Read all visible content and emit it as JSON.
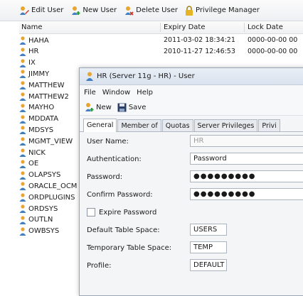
{
  "toolbar": {
    "edit_user": "Edit User",
    "new_user": "New User",
    "delete_user": "Delete User",
    "privilege_manager": "Privilege Manager"
  },
  "columns": {
    "name": "Name",
    "expiry": "Expiry Date",
    "lock": "Lock Date"
  },
  "users": [
    {
      "name": "HAHA",
      "expiry": "2011-03-02 18:34:21",
      "lock": "0000-00-00 00"
    },
    {
      "name": "HR",
      "expiry": "2010-11-27 12:46:53",
      "lock": "0000-00-00 00"
    },
    {
      "name": "IX",
      "expiry": "",
      "lock": ""
    },
    {
      "name": "JIMMY",
      "expiry": "",
      "lock": ""
    },
    {
      "name": "MATTHEW",
      "expiry": "",
      "lock": ""
    },
    {
      "name": "MATTHEW2",
      "expiry": "",
      "lock": ""
    },
    {
      "name": "MAYHO",
      "expiry": "",
      "lock": ""
    },
    {
      "name": "MDDATA",
      "expiry": "",
      "lock": ""
    },
    {
      "name": "MDSYS",
      "expiry": "",
      "lock": ""
    },
    {
      "name": "MGMT_VIEW",
      "expiry": "",
      "lock": ""
    },
    {
      "name": "NICK",
      "expiry": "",
      "lock": ""
    },
    {
      "name": "OE",
      "expiry": "",
      "lock": ""
    },
    {
      "name": "OLAPSYS",
      "expiry": "",
      "lock": ""
    },
    {
      "name": "ORACLE_OCM",
      "expiry": "",
      "lock": ""
    },
    {
      "name": "ORDPLUGINS",
      "expiry": "",
      "lock": ""
    },
    {
      "name": "ORDSYS",
      "expiry": "",
      "lock": ""
    },
    {
      "name": "OUTLN",
      "expiry": "",
      "lock": ""
    },
    {
      "name": "OWBSYS",
      "expiry": "",
      "lock": ""
    }
  ],
  "dialog": {
    "title": "HR (Server 11g - HR) - User",
    "menu": [
      "File",
      "Window",
      "Help"
    ],
    "new_label": "New",
    "save_label": "Save",
    "tabs": [
      "General",
      "Member of",
      "Quotas",
      "Server Privileges",
      "Privi"
    ],
    "active_tab": "General",
    "fields": {
      "user_name_label": "User Name:",
      "user_name_value": "HR",
      "authentication_label": "Authentication:",
      "authentication_value": "Password",
      "password_label": "Password:",
      "password_value": "●●●●●●●●●",
      "confirm_label": "Confirm Password:",
      "confirm_value": "●●●●●●●●●",
      "expire_label": "Expire Password",
      "default_ts_label": "Default Table Space:",
      "default_ts_value": "USERS",
      "temp_ts_label": "Temporary Table Space:",
      "temp_ts_value": "TEMP",
      "profile_label": "Profile:",
      "profile_value": "DEFAULT"
    }
  },
  "colors": {
    "user_icon_head": "#e8a530",
    "user_icon_body": "#3f7fc2",
    "save_icon": "#2b3f66",
    "lock_icon": "#e6b422"
  }
}
